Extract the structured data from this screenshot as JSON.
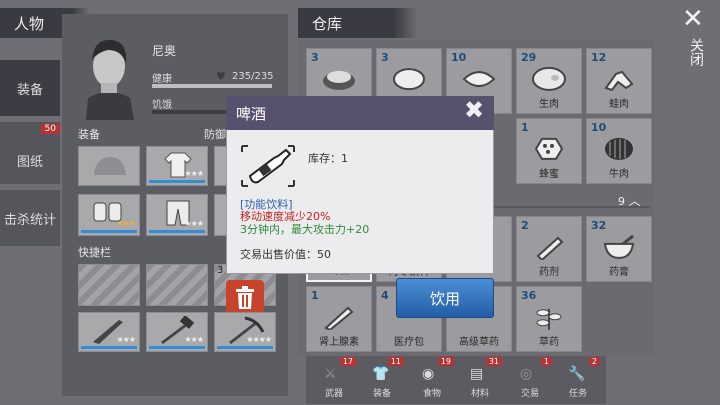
{
  "left_tabs": {
    "equip": "装备",
    "blueprint": "图纸",
    "blueprint_badge": "50",
    "kills": "击杀统计"
  },
  "character": {
    "title": "人物",
    "name": "尼奥",
    "health_label": "健康",
    "health_value": "235/235",
    "hunger_label": "饥饿",
    "equip_label": "装备",
    "defense_label": "防御",
    "quickbar_label": "快捷栏",
    "slot_badge": "3"
  },
  "storage": {
    "title": "仓库",
    "page_indicator": "9",
    "items_row1": [
      {
        "count": "3",
        "name": ""
      },
      {
        "count": "3",
        "name": ""
      },
      {
        "count": "10",
        "name": ""
      },
      {
        "count": "29",
        "name": "生肉"
      },
      {
        "count": "12",
        "name": "蛙肉"
      }
    ],
    "items_row2": [
      {
        "count": "1",
        "name": "蜂蜜"
      },
      {
        "count": "10",
        "name": "牛肉"
      }
    ],
    "items_row3": [
      {
        "count": "",
        "name": "啤酒"
      },
      {
        "count": "",
        "name": "丹冬饮料"
      },
      {
        "count": "",
        "name": ""
      },
      {
        "count": "2",
        "name": "药剂"
      },
      {
        "count": "32",
        "name": "药膏"
      }
    ],
    "items_row4": [
      {
        "count": "1",
        "name": "肾上腺素"
      },
      {
        "count": "4",
        "name": "医疗包"
      },
      {
        "count": "",
        "name": "高级草药"
      },
      {
        "count": "36",
        "name": "草药"
      }
    ]
  },
  "bottom_tabs": [
    {
      "label": "武器",
      "badge": "17"
    },
    {
      "label": "装备",
      "badge": "11"
    },
    {
      "label": "食物",
      "badge": "19"
    },
    {
      "label": "材料",
      "badge": "31"
    },
    {
      "label": "交易",
      "badge": "1"
    },
    {
      "label": "任务",
      "badge": "2"
    }
  ],
  "close_label": "关闭",
  "popup": {
    "title": "啤酒",
    "stock": "库存：1",
    "category": "[功能饮料]",
    "effect1": "移动速度减少20%",
    "effect2": "3分钟内，最大攻击力+20",
    "price": "交易出售价值：50",
    "use_button": "饮用"
  },
  "colors": {
    "accent_purple": "#57516e",
    "button_blue": "#2e6fb6",
    "effect_red": "#c0231f",
    "effect_green": "#2e8a3a",
    "category_blue": "#2e5fa8"
  }
}
